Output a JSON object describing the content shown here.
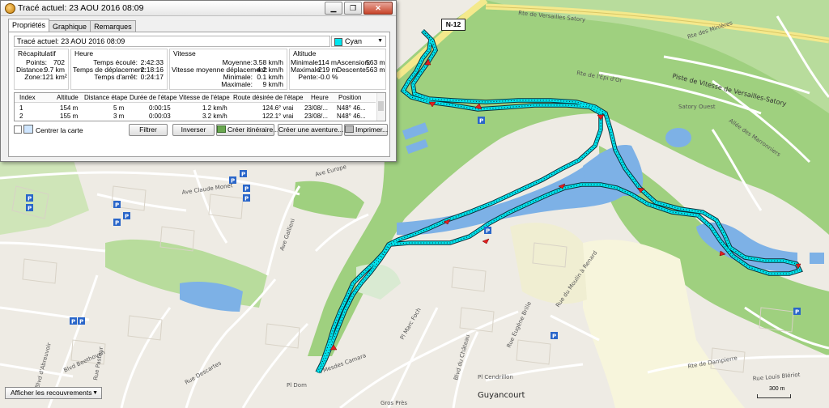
{
  "window": {
    "title": "Tracé actuel: 23 AOU 2016 08:09",
    "minimize": "▁",
    "restore": "❐",
    "close": "✕"
  },
  "tabs": [
    {
      "label": "Propriétés"
    },
    {
      "label": "Graphique"
    },
    {
      "label": "Remarques"
    }
  ],
  "track": {
    "name": "Tracé actuel: 23 AOU 2016 08:09",
    "color_name": "Cyan",
    "color_hex": "#00e5ee"
  },
  "summary": {
    "title": "Récapitulatif",
    "points_label": "Points:",
    "points": "702",
    "distance_label": "Distance:",
    "distance": "9.7 km",
    "zone_label": "Zone:",
    "zone": "121 km²"
  },
  "time": {
    "title": "Heure",
    "elapsed_label": "Temps écoulé:",
    "elapsed": "2:42:33",
    "moving_label": "Temps de déplacement:",
    "moving": "2:18:16",
    "stopped_label": "Temps d'arrêt:",
    "stopped": "0:24:17"
  },
  "speed": {
    "title": "Vitesse",
    "avg_label": "Moyenne:",
    "avg": "3.58 km/h",
    "avg_moving_label": "Vitesse moyenne déplacement:",
    "avg_moving": "4.2 km/h",
    "min_label": "Minimale:",
    "min": "0.1 km/h",
    "max_label": "Maximale:",
    "max": "9 km/h"
  },
  "altitude": {
    "title": "Altitude",
    "min_label": "Minimale:",
    "min": "114 m",
    "max_label": "Maximale:",
    "max": "219 m",
    "slope_label": "Pente:",
    "slope": "-0.0 %",
    "ascent_label": "Ascension:",
    "ascent": "563 m",
    "descent_label": "Descente:",
    "descent": "563 m"
  },
  "table": {
    "columns": [
      "Index",
      "Altitude",
      "Distance étape",
      "Durée de l'étape",
      "Vitesse de l'étape",
      "Route désirée de l'étape",
      "Heure",
      "Position"
    ],
    "rows": [
      [
        "1",
        "154 m",
        "5 m",
        "0:00:15",
        "1.2 km/h",
        "124.6° vrai",
        "23/08/...",
        "N48° 46..."
      ],
      [
        "2",
        "155 m",
        "3 m",
        "0:00:03",
        "3.2 km/h",
        "122.1° vrai",
        "23/08/...",
        "N48° 46..."
      ]
    ]
  },
  "center_label": "Centrer la carte",
  "buttons": {
    "filter": "Filtrer",
    "reverse": "Inverser",
    "create_route": "Créer itinéraire...",
    "create_adventure": "Créer une aventure...",
    "print": "Imprimer..."
  },
  "map": {
    "overlay_select": "Afficher les recouvrements",
    "scale": "300 m",
    "road_shield": "N-12",
    "track_color": "#00e5ee",
    "labels": {
      "rte_versailles_satory": "Rte de Versailles Satory",
      "rte_minieres": "Rte des Minières",
      "rte_lepi_dor": "Rte de l'Epi d'Or",
      "piste_vitesse": "Piste de Vitesse de Versailles-Satory",
      "satory_ouest": "Satory Ouest",
      "allee_marronniers": "Allée des Marronniers",
      "ave_europe": "Ave Europe",
      "ave_claude_monet": "Ave Claude Monet",
      "ave_gallieni": "Ave Gallieni",
      "bd_beethoven": "Blvd Beethoven",
      "bd_abreuvoir": "Blvd d'Abreuvoir",
      "rue_pasteur": "Rue Pasteur",
      "bd_chateau": "Blvd du Château",
      "rue_dampierre": "Rte de Dampierre",
      "rue_louis_bleriot": "Rue Louis Blériot",
      "bd_moulin": "Rue du Moulin à Renard",
      "pl_cendrillon": "Pl Cendrillon",
      "guyancourt": "Guyancourt",
      "pl_dom": "Pl Dom",
      "mesdes_camara": "Mesdes Camara",
      "rue_eugene": "Rue Eugène Brille",
      "gros_pres": "Gros Près",
      "rue_descartes": "Rue Descartes",
      "ave_foch": "Pl Marc Foch"
    }
  }
}
